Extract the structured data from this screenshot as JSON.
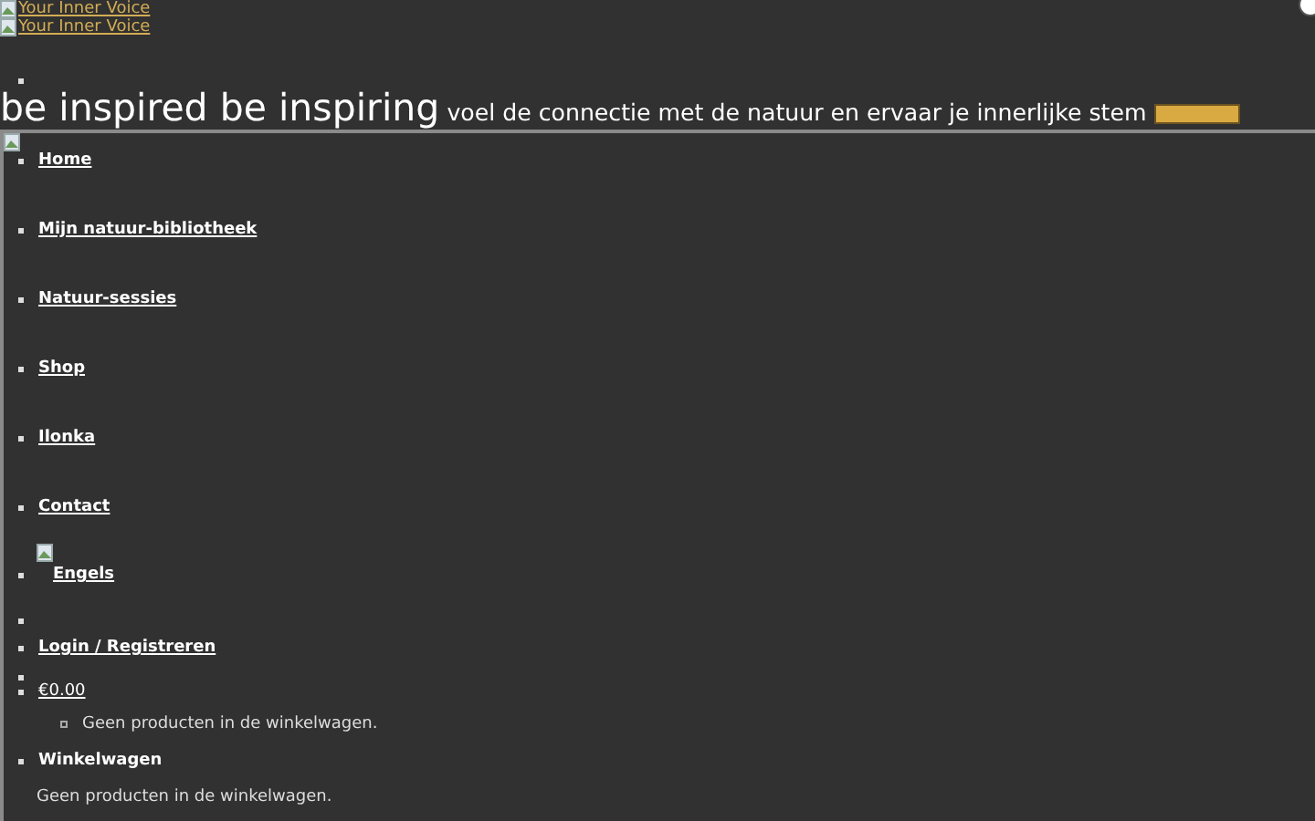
{
  "logo_links": [
    "Your Inner Voice",
    "Your Inner Voice"
  ],
  "headline": {
    "title": "be inspired be inspiring",
    "tagline_parts": [
      "voel de connectie met de natuur",
      "en ervaar je innerlijke stem"
    ]
  },
  "nav": [
    {
      "label": "Home",
      "kind": "link"
    },
    {
      "label": "Mijn natuur-bibliotheek",
      "kind": "link"
    },
    {
      "label": "Natuur-sessies",
      "kind": "link"
    },
    {
      "label": "Shop",
      "kind": "link"
    },
    {
      "label": "Ilonka",
      "kind": "link"
    },
    {
      "label": "Contact",
      "kind": "link"
    },
    {
      "label": "Engels",
      "kind": "language"
    },
    {
      "kind": "empty"
    },
    {
      "label": "Login / Registreren",
      "kind": "link"
    }
  ],
  "cart": {
    "total": "€0.00",
    "empty_message": "Geen producten in de winkelwagen."
  },
  "cart_widget": {
    "title": "Winkelwagen",
    "message": "Geen producten in de winkelwagen."
  }
}
